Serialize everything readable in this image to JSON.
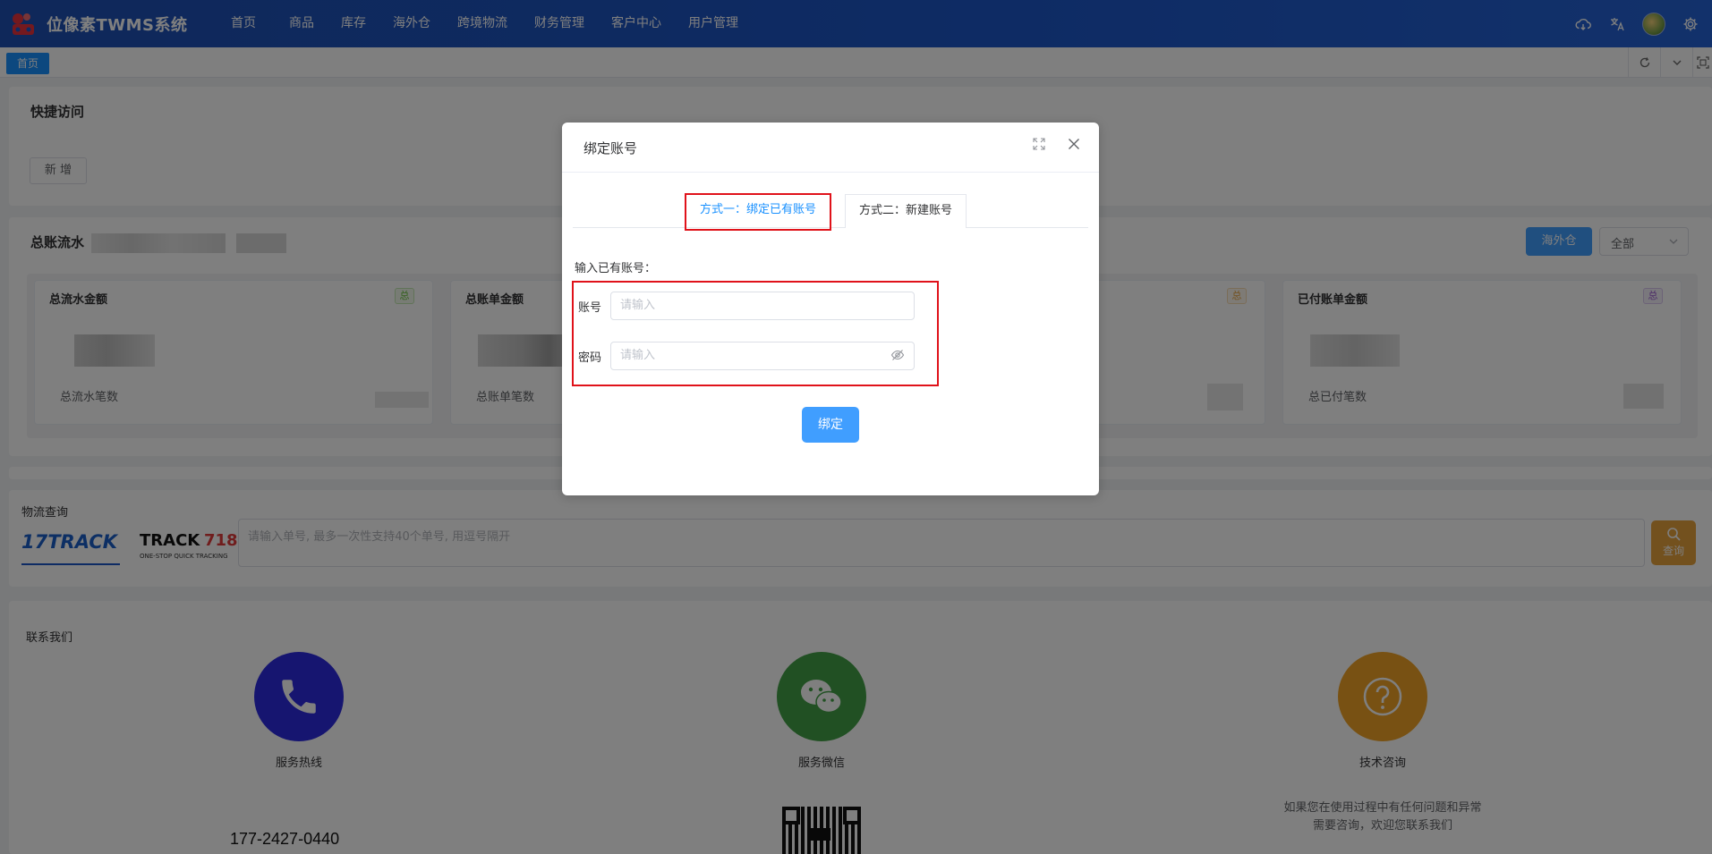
{
  "app": {
    "title": "位像素TWMS系统"
  },
  "nav": {
    "items": [
      "首页",
      "商品",
      "库存",
      "海外仓",
      "跨境物流",
      "财务管理",
      "客户中心",
      "用户管理"
    ]
  },
  "tabs": {
    "home": "首页"
  },
  "quick_access": {
    "title": "快捷访问",
    "add_label": "新 增"
  },
  "ledger": {
    "title": "总账流水",
    "warehouse_button": "海外仓",
    "filter_value": "全部",
    "cards": [
      {
        "title": "总流水金额",
        "badge": "总",
        "sub": "总流水笔数"
      },
      {
        "title": "总账单金额",
        "badge": "总",
        "sub": "总账单笔数"
      },
      {
        "title": "",
        "badge": "总",
        "sub": ""
      },
      {
        "title": "已付账单金额",
        "badge": "总",
        "sub": "总已付笔数"
      }
    ]
  },
  "tracking": {
    "title": "物流查询",
    "brand1": "17TRACK",
    "brand2_main": "TRACK",
    "brand2_num": "718",
    "brand2_sub": "ONE-STOP QUICK TRACKING",
    "placeholder": "请输入单号, 最多一次性支持40个单号, 用逗号隔开",
    "query_label": "查询"
  },
  "contact": {
    "title": "联系我们",
    "hotline_label": "服务热线",
    "hotline_number": "177-2427-0440",
    "wechat_label": "服务微信",
    "tech_label": "技术咨询",
    "tech_desc_1": "如果您在使用过程中有任何问题和异常",
    "tech_desc_2": "需要咨询，欢迎您联系我们"
  },
  "dialog": {
    "title": "绑定账号",
    "tab_active": "方式一：绑定已有账号",
    "tab_inactive": "方式二：新建账号",
    "section_label": "输入已有账号：",
    "account_label": "账号",
    "account_placeholder": "请输入",
    "password_label": "密码",
    "password_placeholder": "请输入",
    "submit_label": "绑定"
  },
  "colors": {
    "nav_bg": "#1d57c9",
    "primary": "#409eff",
    "highlight": "#e0121a",
    "phone": "#2c2ae0",
    "wechat": "#43a047",
    "tech": "#f0a326"
  }
}
